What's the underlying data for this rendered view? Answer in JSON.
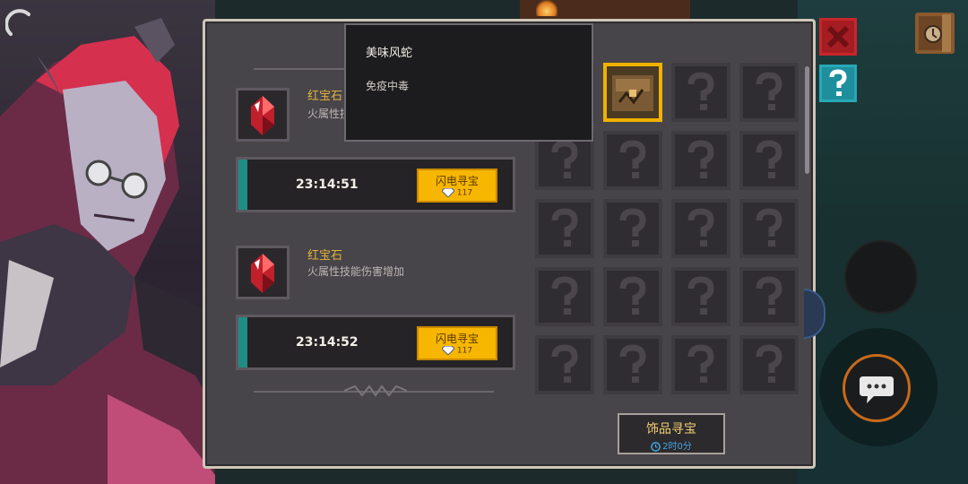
{
  "entries": [
    {
      "name": "红宝石",
      "desc": "火属性技能伤害增加",
      "timer": "23:14:51",
      "button_label": "闪电寻宝",
      "cost": "117"
    },
    {
      "name": "红宝石",
      "desc": "火属性技能伤害增加",
      "timer": "23:14:52",
      "button_label": "闪电寻宝",
      "cost": "117"
    }
  ],
  "tooltip": {
    "title": "美味风蛇",
    "subtitle": "免疫中毒"
  },
  "treasure": {
    "label": "饰品寻宝",
    "time": "2时0分"
  },
  "grid": {
    "rows": 5,
    "cols": 4,
    "selected_index": 1
  },
  "colors": {
    "accent_gold": "#f7b600",
    "accent_teal": "#1f8d86",
    "panel_bg": "#474549",
    "timer_blue": "#3fa7e4",
    "close_red": "#c8262b",
    "help_teal": "#27a8b7"
  },
  "icons": [
    "loading-icon",
    "ruby-gem-icon",
    "diamond-icon",
    "clock-icon",
    "close-icon",
    "help-icon",
    "book-icon",
    "chat-icon",
    "question-mark-icon",
    "chest-icon"
  ]
}
